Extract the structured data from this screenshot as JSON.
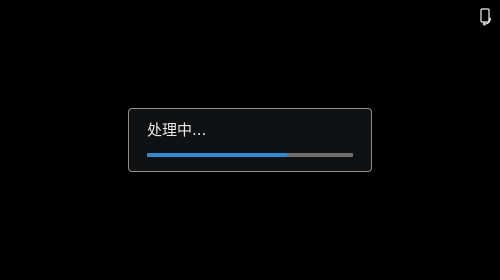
{
  "status_bar": {
    "icon": "phone-rotate-icon"
  },
  "dialog": {
    "message": "处理中...",
    "progress": 0.68
  },
  "colors": {
    "background": "#000000",
    "dialog_background": "#0f1113",
    "dialog_border": "#8e8e8e",
    "text": "#e9e9e9",
    "progress_fill": "#2f8ad4",
    "progress_track": "#6f6f6f"
  }
}
